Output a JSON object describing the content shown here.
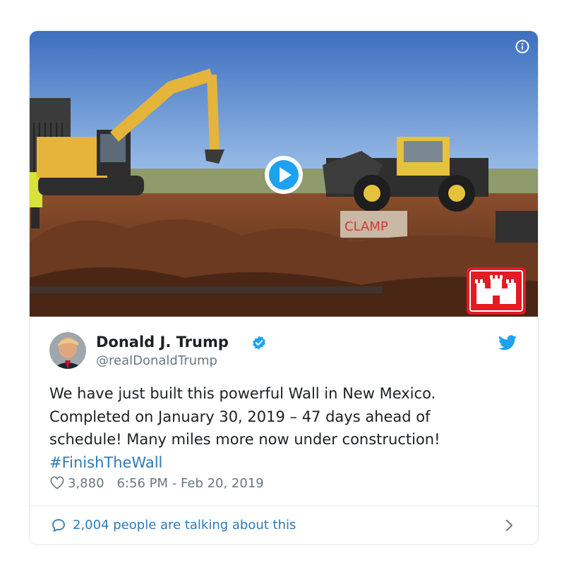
{
  "media": {
    "info_icon": "info-icon",
    "play_icon": "play-icon",
    "sign_text": "CLAMP",
    "logo": "castle-logo"
  },
  "author": {
    "name": "Donald J. Trump",
    "handle": "@realDonaldTrump",
    "verified": true,
    "verified_color": "#1da1f2"
  },
  "tweet": {
    "lines": [
      "We have just built this powerful Wall in New Mexico.",
      "Completed on January 30, 2019 – 47 days ahead of",
      "schedule! Many miles more now under construction!"
    ],
    "hashtag": "#FinishTheWall"
  },
  "meta": {
    "likes": "3,880",
    "timestamp": "6:56 PM - Feb 20, 2019"
  },
  "footer": {
    "talking": "2,004 people are talking about this"
  },
  "colors": {
    "link": "#2b7bb9",
    "muted": "#697882",
    "border": "#e1e8ed",
    "twitter_blue": "#1da1f2",
    "logo_red": "#e31b23"
  }
}
